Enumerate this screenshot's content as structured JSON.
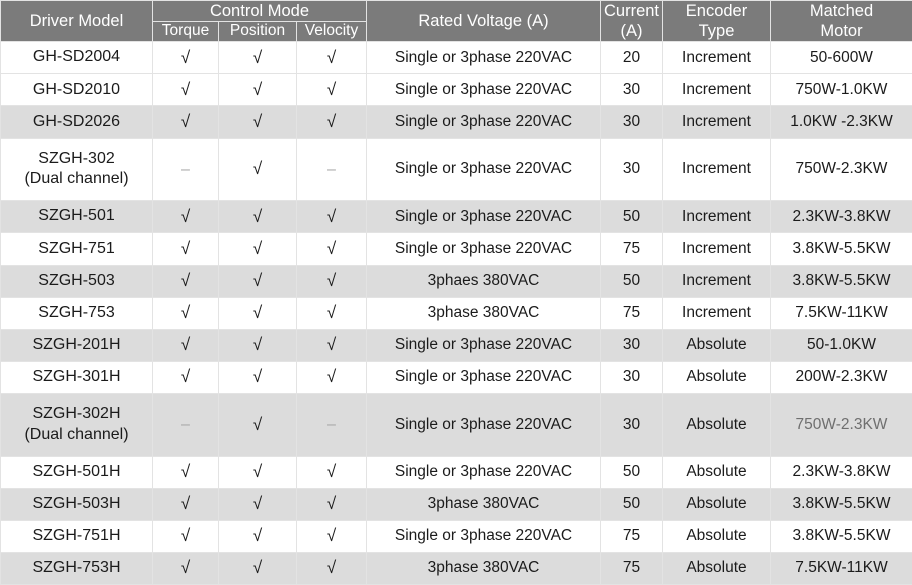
{
  "table": {
    "headers": {
      "driver_model": "Driver Model",
      "control_mode": "Control Mode",
      "torque": "Torque",
      "position": "Position",
      "velocity": "Velocity",
      "rated_voltage": "Rated Voltage (A)",
      "current_line1": "Current",
      "current_line2": "(A)",
      "encoder_line1": "Encoder",
      "encoder_line2": "Type",
      "matched_line1": "Matched",
      "matched_line2": "Motor"
    },
    "marks": {
      "yes": "√",
      "no": "–"
    },
    "colors": {
      "header_bg": "#7b7b7b",
      "header_text": "#ffffff",
      "row_shaded_bg": "#dcdcdc",
      "row_plain_bg": "#ffffff",
      "body_text": "#1b1b1b",
      "muted_text": "#6f6f6f",
      "grid_line": "#e3e3e3"
    },
    "rows": [
      {
        "model": "GH-SD2004",
        "model_sub": "",
        "shaded": false,
        "torque": "yes",
        "position": "yes",
        "velocity": "yes",
        "voltage": "Single or 3phase 220VAC",
        "current": "20",
        "encoder": "Increment",
        "motor": "50-600W",
        "motor_dim": false
      },
      {
        "model": "GH-SD2010",
        "model_sub": "",
        "shaded": false,
        "torque": "yes",
        "position": "yes",
        "velocity": "yes",
        "voltage": "Single or 3phase 220VAC",
        "current": "30",
        "encoder": "Increment",
        "motor": "750W-1.0KW",
        "motor_dim": false
      },
      {
        "model": "GH-SD2026",
        "model_sub": "",
        "shaded": true,
        "torque": "yes",
        "position": "yes",
        "velocity": "yes",
        "voltage": "Single or 3phase 220VAC",
        "current": "30",
        "encoder": "Increment",
        "motor": "1.0KW -2.3KW",
        "motor_dim": false
      },
      {
        "model": "SZGH-302",
        "model_sub": "(Dual channel)",
        "shaded": false,
        "torque": "no",
        "position": "yes",
        "velocity": "no",
        "voltage": "Single or 3phase 220VAC",
        "current": "30",
        "encoder": "Increment",
        "motor": "750W-2.3KW",
        "motor_dim": false
      },
      {
        "model": "SZGH-501",
        "model_sub": "",
        "shaded": true,
        "torque": "yes",
        "position": "yes",
        "velocity": "yes",
        "voltage": "Single or 3phase 220VAC",
        "current": "50",
        "encoder": "Increment",
        "motor": "2.3KW-3.8KW",
        "motor_dim": false
      },
      {
        "model": "SZGH-751",
        "model_sub": "",
        "shaded": false,
        "torque": "yes",
        "position": "yes",
        "velocity": "yes",
        "voltage": "Single or 3phase 220VAC",
        "current": "75",
        "encoder": "Increment",
        "motor": "3.8KW-5.5KW",
        "motor_dim": false
      },
      {
        "model": "SZGH-503",
        "model_sub": "",
        "shaded": true,
        "torque": "yes",
        "position": "yes",
        "velocity": "yes",
        "voltage": "3phaes 380VAC",
        "current": "50",
        "encoder": "Increment",
        "motor": "3.8KW-5.5KW",
        "motor_dim": false
      },
      {
        "model": "SZGH-753",
        "model_sub": "",
        "shaded": false,
        "torque": "yes",
        "position": "yes",
        "velocity": "yes",
        "voltage": "3phase 380VAC",
        "current": "75",
        "encoder": "Increment",
        "motor": "7.5KW-11KW",
        "motor_dim": false
      },
      {
        "model": "SZGH-201H",
        "model_sub": "",
        "shaded": true,
        "torque": "yes",
        "position": "yes",
        "velocity": "yes",
        "voltage": "Single or 3phase 220VAC",
        "current": "30",
        "encoder": "Absolute",
        "motor": "50-1.0KW",
        "motor_dim": false
      },
      {
        "model": "SZGH-301H",
        "model_sub": "",
        "shaded": false,
        "torque": "yes",
        "position": "yes",
        "velocity": "yes",
        "voltage": "Single or 3phase 220VAC",
        "current": "30",
        "encoder": "Absolute",
        "motor": "200W-2.3KW",
        "motor_dim": false
      },
      {
        "model": "SZGH-302H",
        "model_sub": "(Dual channel)",
        "shaded": true,
        "torque": "no",
        "position": "yes",
        "velocity": "no",
        "voltage": "Single or 3phase 220VAC",
        "current": "30",
        "encoder": "Absolute",
        "motor": "750W-2.3KW",
        "motor_dim": true
      },
      {
        "model": "SZGH-501H",
        "model_sub": "",
        "shaded": false,
        "torque": "yes",
        "position": "yes",
        "velocity": "yes",
        "voltage": "Single or 3phase 220VAC",
        "current": "50",
        "encoder": "Absolute",
        "motor": "2.3KW-3.8KW",
        "motor_dim": false
      },
      {
        "model": "SZGH-503H",
        "model_sub": "",
        "shaded": true,
        "torque": "yes",
        "position": "yes",
        "velocity": "yes",
        "voltage": "3phase 380VAC",
        "current": "50",
        "encoder": "Absolute",
        "motor": "3.8KW-5.5KW",
        "motor_dim": false
      },
      {
        "model": "SZGH-751H",
        "model_sub": "",
        "shaded": false,
        "torque": "yes",
        "position": "yes",
        "velocity": "yes",
        "voltage": "Single or 3phase 220VAC",
        "current": "75",
        "encoder": "Absolute",
        "motor": "3.8KW-5.5KW",
        "motor_dim": false
      },
      {
        "model": "SZGH-753H",
        "model_sub": "",
        "shaded": true,
        "torque": "yes",
        "position": "yes",
        "velocity": "yes",
        "voltage": "3phase 380VAC",
        "current": "75",
        "encoder": "Absolute",
        "motor": "7.5KW-11KW",
        "motor_dim": false
      }
    ]
  }
}
